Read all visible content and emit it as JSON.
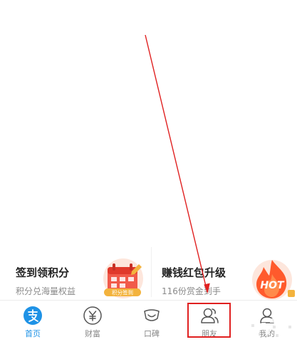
{
  "promos": [
    {
      "title": "签到领积分",
      "subtitle": "积分兑海量权益",
      "illustration": "calendar-icon",
      "badge_text": "积分签到"
    },
    {
      "title": "赚钱红包升级",
      "subtitle": "116份赏金到手",
      "illustration": "flame-icon",
      "badge_text": "HOT"
    }
  ],
  "tabbar": {
    "tabs": [
      {
        "label": "首页",
        "icon": "alipay-logo-icon",
        "active": true
      },
      {
        "label": "财富",
        "icon": "yen-coin-icon",
        "active": false
      },
      {
        "label": "口碑",
        "icon": "koubei-smile-icon",
        "active": false
      },
      {
        "label": "朋友",
        "icon": "friends-icon",
        "active": false
      },
      {
        "label": "我的",
        "icon": "profile-icon",
        "active": false
      }
    ]
  },
  "annotation": {
    "color": "#e02020",
    "target": "朋友"
  },
  "colors": {
    "accent": "#1e92e6",
    "inactive": "#888888",
    "annotation_red": "#e02020",
    "hot_orange": "#ff5a2c",
    "calendar_red": "#f15a4a",
    "badge_yellow": "#f3b33d"
  }
}
